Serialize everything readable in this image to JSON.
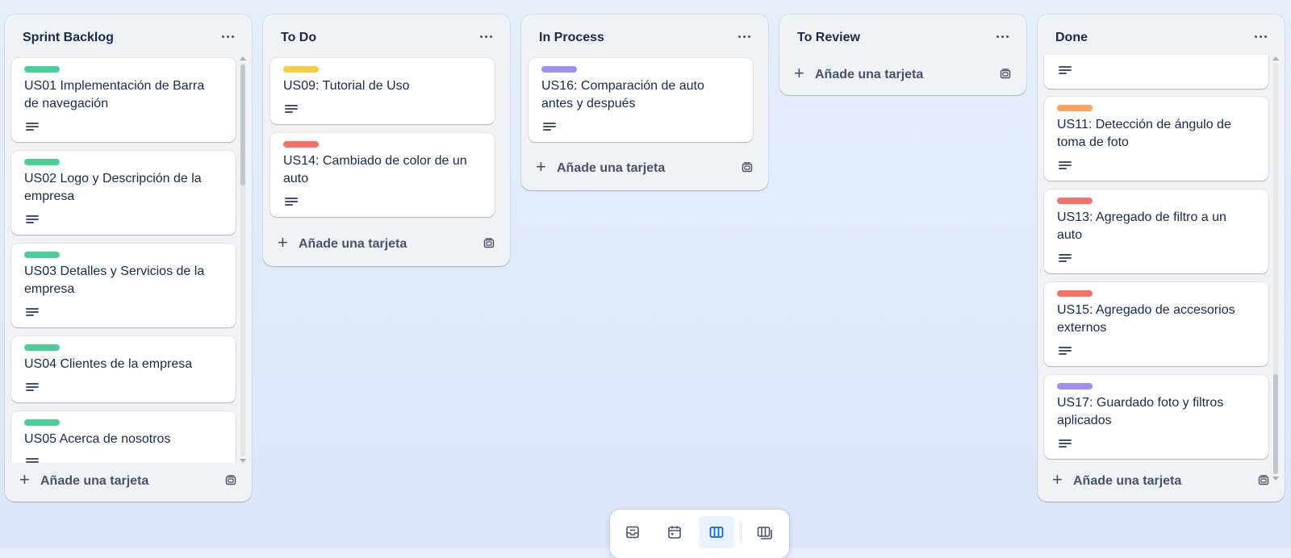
{
  "board": {
    "lists": [
      {
        "title": "Sprint Backlog",
        "menu_icon": "ellipsis-icon",
        "add_card_label": "Añade una tarjeta",
        "cards": [
          {
            "title": "US01 Implementación de Barra de navegación",
            "label_color": "#4bce97",
            "has_description": true
          },
          {
            "title": "US02 Logo y Descripción de la empresa",
            "label_color": "#4bce97",
            "has_description": true
          },
          {
            "title": "US03 Detalles y Servicios de la empresa",
            "label_color": "#4bce97",
            "has_description": true
          },
          {
            "title": "US04 Clientes de la empresa",
            "label_color": "#4bce97",
            "has_description": true
          },
          {
            "title": "US05 Acerca de nosotros",
            "label_color": "#4bce97",
            "has_description": true
          }
        ]
      },
      {
        "title": "To Do",
        "menu_icon": "ellipsis-icon",
        "add_card_label": "Añade una tarjeta",
        "cards": [
          {
            "title": "US09: Tutorial de Uso",
            "label_color": "#f5cd47",
            "has_description": true
          },
          {
            "title": "US14: Cambiado de color de un auto",
            "label_color": "#f87168",
            "has_description": true
          }
        ]
      },
      {
        "title": "In Process",
        "menu_icon": "ellipsis-icon",
        "add_card_label": "Añade una tarjeta",
        "cards": [
          {
            "title": "US16: Comparación de auto antes y después",
            "label_color": "#9f8fef",
            "has_description": true
          }
        ]
      },
      {
        "title": "To Review",
        "menu_icon": "ellipsis-icon",
        "add_card_label": "Añade una tarjeta",
        "cards": []
      },
      {
        "title": "Done",
        "menu_icon": "ellipsis-icon",
        "add_card_label": "Añade una tarjeta",
        "cards": [
          {
            "title": "",
            "label_color": "",
            "has_description": true
          },
          {
            "title": "US11: Detección de ángulo de toma de foto",
            "label_color": "#fea362",
            "has_description": true
          },
          {
            "title": "US13: Agregado de filtro a un auto",
            "label_color": "#f87168",
            "has_description": true
          },
          {
            "title": "US15: Agregado de accesorios externos",
            "label_color": "#f87168",
            "has_description": true
          },
          {
            "title": "US17: Guardado foto y filtros aplicados",
            "label_color": "#9f8fef",
            "has_description": true
          }
        ]
      }
    ]
  },
  "view_switcher": {
    "items": [
      {
        "icon": "inbox-icon",
        "active": false
      },
      {
        "icon": "calendar-icon",
        "active": false
      },
      {
        "icon": "board-icon",
        "active": true
      },
      {
        "icon": "switch-boards-icon",
        "active": false
      }
    ]
  },
  "colors": {
    "accent": "#0c66e4",
    "list_bg": "#f1f2f4",
    "card_bg": "#ffffff"
  }
}
